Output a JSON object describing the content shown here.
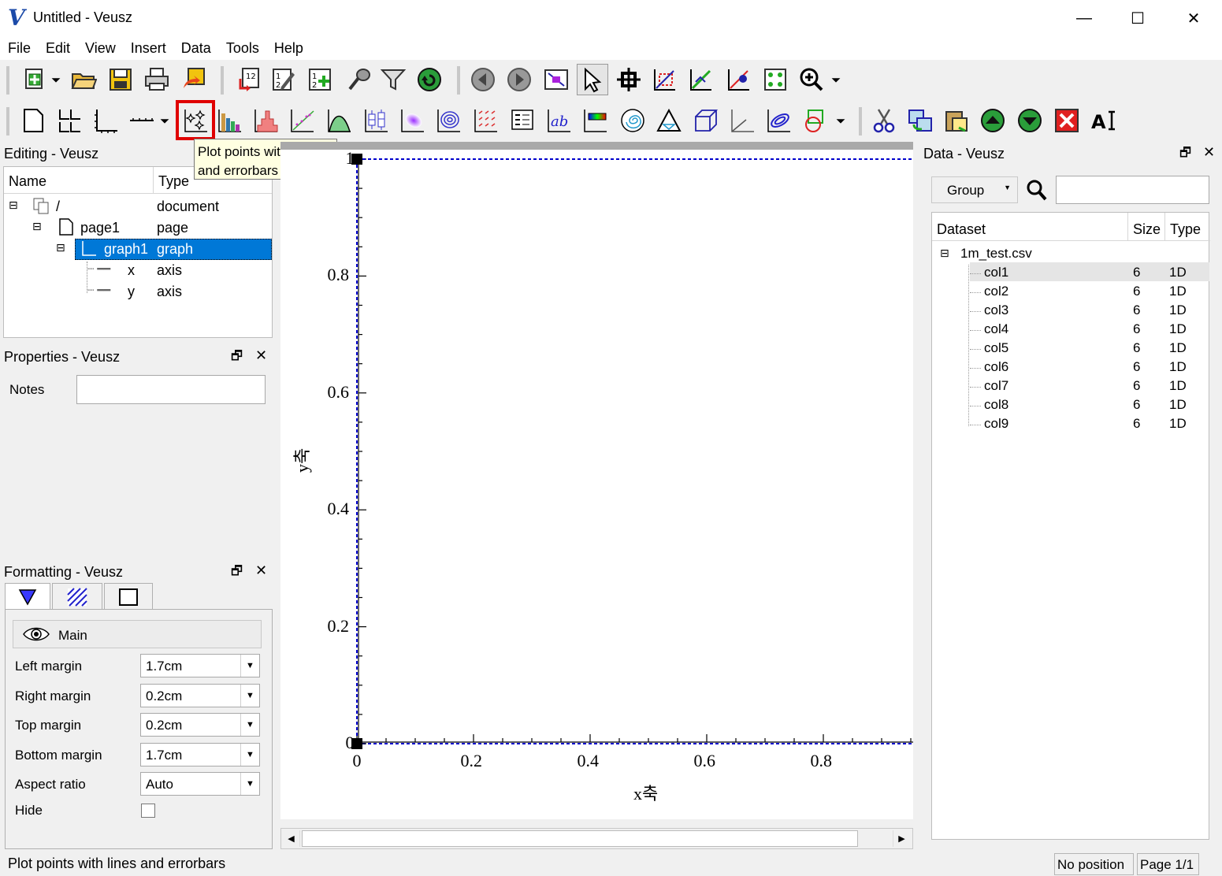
{
  "window": {
    "title": "Untitled - Veusz",
    "logo": "V",
    "controls": {
      "minimize": "—",
      "maximize": "☐",
      "close": "✕"
    }
  },
  "menu": [
    "File",
    "Edit",
    "View",
    "Insert",
    "Data",
    "Tools",
    "Help"
  ],
  "toolbar_main_icons": [
    "new-document-icon",
    "open-folder-icon",
    "save-icon",
    "print-icon",
    "export-icon",
    "import-data-icon",
    "edit-data-icon",
    "create-dataset-icon",
    "capture-icon",
    "filter-icon",
    "reload-icon",
    "previous-page-icon",
    "next-page-icon",
    "fullscreen-icon",
    "select-pointer-icon",
    "pick-point-icon",
    "zoom-graph-icon",
    "zoom-reset-icon",
    "read-point-icon",
    "view-zoom-icon"
  ],
  "toolbar_widget_icons": [
    "page-icon",
    "grid-icon",
    "graph-icon",
    "axis-icon",
    "xy-plot-icon",
    "bar-chart-icon",
    "histogram-icon",
    "fit-icon",
    "function-icon",
    "boxplot-icon",
    "image-icon",
    "contour-icon",
    "vector-field-icon",
    "key-icon",
    "label-icon",
    "colorbar-icon",
    "polar-icon",
    "ternary-icon",
    "3d-scene-icon",
    "axis-broken-icon",
    "ellipse-icon",
    "shape-icon",
    "cut-icon",
    "copy-icon",
    "paste-icon",
    "move-up-icon",
    "move-down-icon",
    "delete-icon",
    "rename-icon"
  ],
  "tooltip": {
    "line1": "Plot points with lines",
    "line2": "and errorbars"
  },
  "editing": {
    "title": "Editing - Veusz",
    "col_name": "Name",
    "col_type": "Type",
    "rows": [
      {
        "name": "/",
        "type": "document"
      },
      {
        "name": "page1",
        "type": "page"
      },
      {
        "name": "graph1",
        "type": "graph"
      },
      {
        "name": "x",
        "type": "axis"
      },
      {
        "name": "y",
        "type": "axis"
      }
    ]
  },
  "properties": {
    "title": "Properties - Veusz",
    "notes_label": "Notes",
    "notes_value": ""
  },
  "formatting": {
    "title": "Formatting - Veusz",
    "section": "Main",
    "fields": [
      {
        "label": "Left margin",
        "value": "1.7cm"
      },
      {
        "label": "Right margin",
        "value": "0.2cm"
      },
      {
        "label": "Top margin",
        "value": "0.2cm"
      },
      {
        "label": "Bottom margin",
        "value": "1.7cm"
      },
      {
        "label": "Aspect ratio",
        "value": "Auto"
      }
    ],
    "hide_label": "Hide",
    "hide_checked": false
  },
  "plot": {
    "xlabel": "x축",
    "ylabel": "y축",
    "xticks": [
      "0",
      "0.2",
      "0.4",
      "0.6",
      "0.8"
    ],
    "yticks": [
      "0",
      "0.2",
      "0.4",
      "0.6",
      "0.8",
      "1"
    ],
    "axis_color": "#0000cc"
  },
  "data": {
    "title": "Data - Veusz",
    "group_label": "Group",
    "search_value": "",
    "col_dataset": "Dataset",
    "col_size": "Size",
    "col_type": "Type",
    "file": "1m_test.csv",
    "datasets": [
      {
        "name": "col1",
        "size": "6",
        "type": "1D"
      },
      {
        "name": "col2",
        "size": "6",
        "type": "1D"
      },
      {
        "name": "col3",
        "size": "6",
        "type": "1D"
      },
      {
        "name": "col4",
        "size": "6",
        "type": "1D"
      },
      {
        "name": "col5",
        "size": "6",
        "type": "1D"
      },
      {
        "name": "col6",
        "size": "6",
        "type": "1D"
      },
      {
        "name": "col7",
        "size": "6",
        "type": "1D"
      },
      {
        "name": "col8",
        "size": "6",
        "type": "1D"
      },
      {
        "name": "col9",
        "size": "6",
        "type": "1D"
      }
    ]
  },
  "status": {
    "message": "Plot points with lines and errorbars",
    "position": "No position",
    "page": "Page 1/1"
  },
  "colors": {
    "selection": "#0078d7",
    "highlight": "#e00000",
    "tooltip_bg": "#ffffe1"
  }
}
